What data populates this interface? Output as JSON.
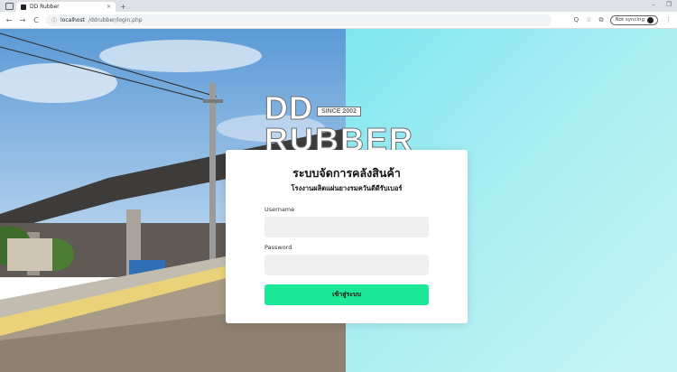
{
  "browser": {
    "tab_title": "DD Rubber",
    "tab_close": "×",
    "new_tab": "+",
    "window_controls": [
      "–",
      "❐"
    ],
    "url_host": "localhost",
    "url_path": "/ddrubber/login.php",
    "pause_label": "Not syncing",
    "nav": {
      "back": "←",
      "forward": "→",
      "reload": "C"
    },
    "tools": [
      "Q",
      "☆",
      "⧉"
    ]
  },
  "logo": {
    "line1": "DD",
    "since": "SINCE 2002",
    "line2": "RUBBER"
  },
  "login": {
    "title": "ระบบจัดการคลังสินค้า",
    "subtitle": "โรงงานผลิตแผ่นยางรมควันดีดีรับเบอร์",
    "username_label": "Username",
    "username_value": "",
    "password_label": "Password",
    "password_value": "",
    "submit_label": "เข้าสู่ระบบ"
  },
  "colors": {
    "accent": "#1de89a",
    "right_panel": "#a8eef3"
  }
}
